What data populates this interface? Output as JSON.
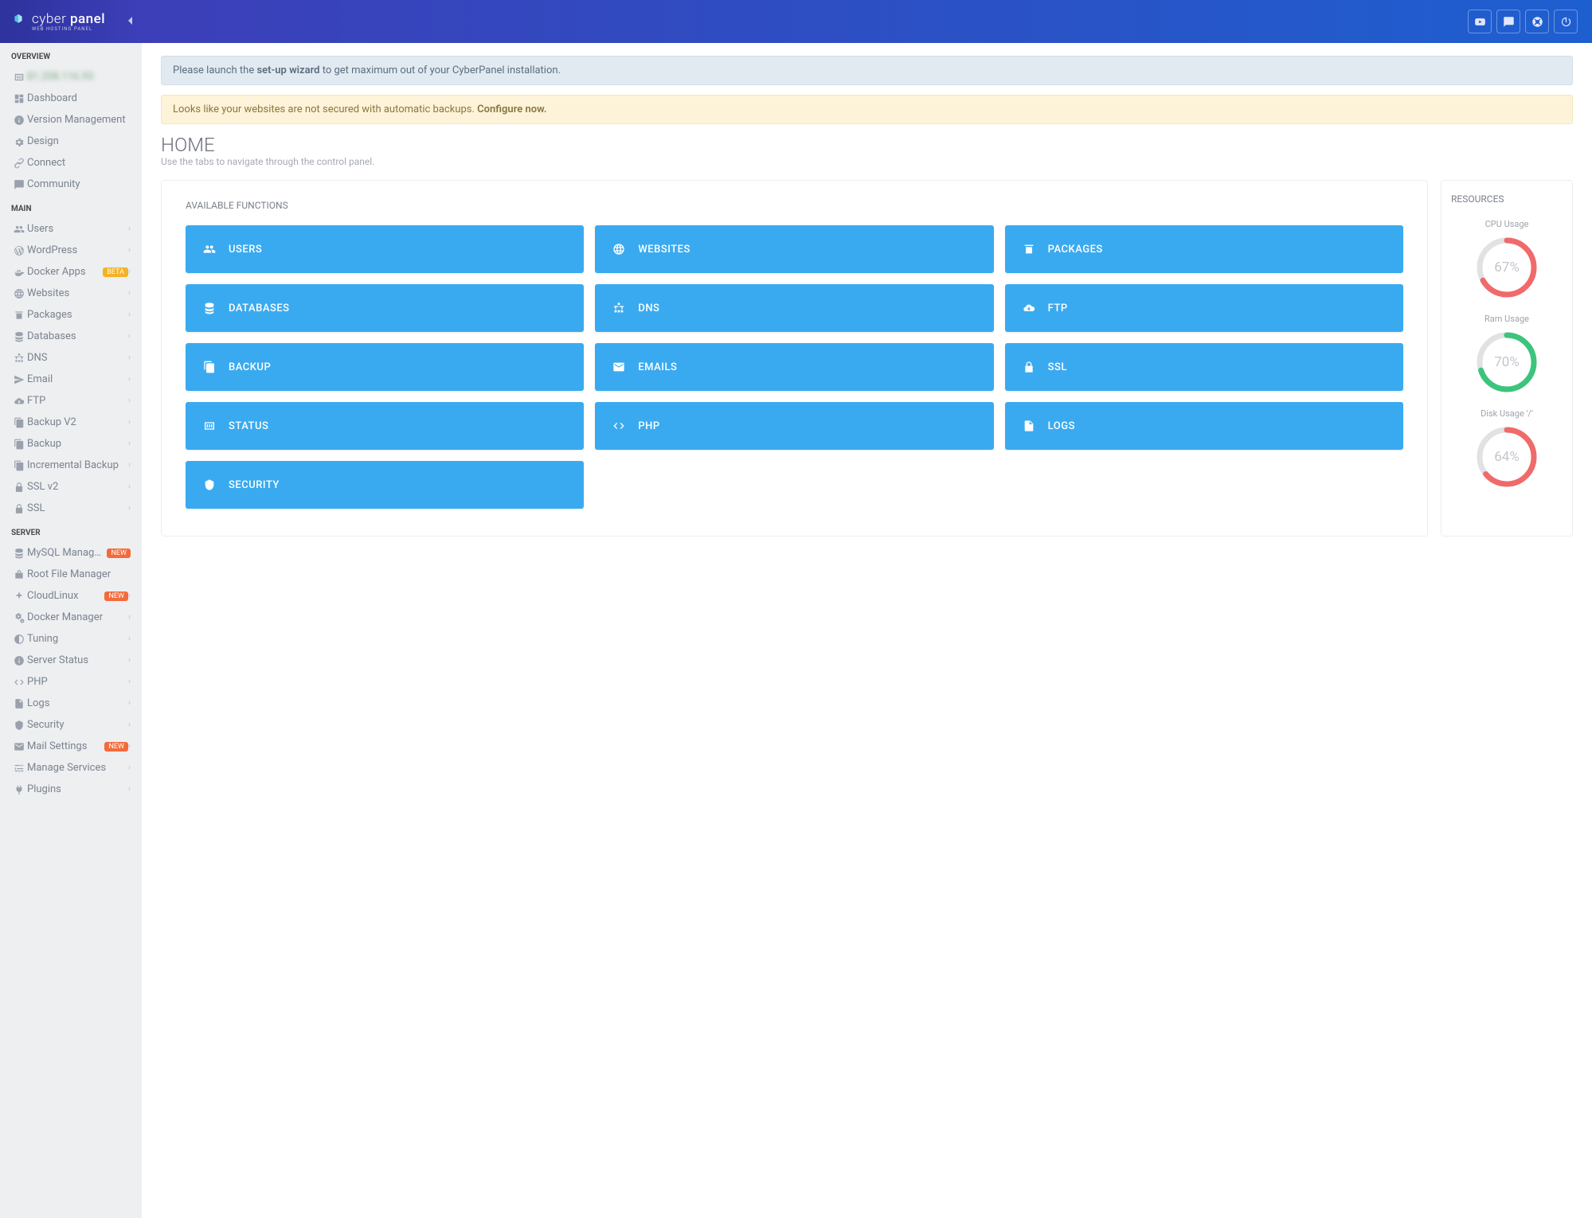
{
  "brand": {
    "name_a": "cyber",
    "name_b": "panel",
    "sub": "WEB HOSTING PANEL"
  },
  "nav": {
    "overview_title": "OVERVIEW",
    "ip": "81.208.116.93",
    "overview": [
      {
        "id": "dashboard",
        "label": "Dashboard",
        "icon": "dashboard",
        "chev": false
      },
      {
        "id": "version-management",
        "label": "Version Management",
        "icon": "info",
        "chev": false
      },
      {
        "id": "design",
        "label": "Design",
        "icon": "gear",
        "chev": false
      },
      {
        "id": "connect",
        "label": "Connect",
        "icon": "link",
        "chev": false
      },
      {
        "id": "community",
        "label": "Community",
        "icon": "chat",
        "chev": false
      }
    ],
    "main_title": "MAIN",
    "main": [
      {
        "id": "users",
        "label": "Users",
        "icon": "users",
        "chev": true
      },
      {
        "id": "wordpress",
        "label": "WordPress",
        "icon": "wordpress",
        "chev": true
      },
      {
        "id": "docker-apps",
        "label": "Docker Apps",
        "icon": "docker",
        "chev": true,
        "badge": "BETA",
        "badge_cls": "badge-beta"
      },
      {
        "id": "websites",
        "label": "Websites",
        "icon": "globe",
        "chev": true
      },
      {
        "id": "packages",
        "label": "Packages",
        "icon": "archive",
        "chev": true
      },
      {
        "id": "databases",
        "label": "Databases",
        "icon": "db",
        "chev": true
      },
      {
        "id": "dns",
        "label": "DNS",
        "icon": "sitemap",
        "chev": true
      },
      {
        "id": "email",
        "label": "Email",
        "icon": "paperplane",
        "chev": true
      },
      {
        "id": "ftp",
        "label": "FTP",
        "icon": "cloud",
        "chev": true
      },
      {
        "id": "backup-v2",
        "label": "Backup V2",
        "icon": "copy",
        "chev": true
      },
      {
        "id": "backup",
        "label": "Backup",
        "icon": "copy",
        "chev": true
      },
      {
        "id": "incremental-backup",
        "label": "Incremental Backup",
        "icon": "copy",
        "chev": true
      },
      {
        "id": "ssl-v2",
        "label": "SSL v2",
        "icon": "lock",
        "chev": true
      },
      {
        "id": "ssl",
        "label": "SSL",
        "icon": "lock",
        "chev": true
      }
    ],
    "server_title": "SERVER",
    "server": [
      {
        "id": "mysql-manager",
        "label": "MySQL Manager",
        "icon": "db",
        "chev": false,
        "badge": "NEW",
        "badge_cls": "badge-new"
      },
      {
        "id": "root-file-manager",
        "label": "Root File Manager",
        "icon": "rootfm",
        "chev": false
      },
      {
        "id": "cloudlinux",
        "label": "CloudLinux",
        "icon": "cloudlinux",
        "chev": true,
        "badge": "NEW",
        "badge_cls": "badge-new"
      },
      {
        "id": "docker-manager",
        "label": "Docker Manager",
        "icon": "gears",
        "chev": true
      },
      {
        "id": "tuning",
        "label": "Tuning",
        "icon": "contrast",
        "chev": true
      },
      {
        "id": "server-status",
        "label": "Server Status",
        "icon": "info",
        "chev": true
      },
      {
        "id": "php",
        "label": "PHP",
        "icon": "code",
        "chev": true
      },
      {
        "id": "logs",
        "label": "Logs",
        "icon": "file",
        "chev": true
      },
      {
        "id": "security",
        "label": "Security",
        "icon": "shield",
        "chev": true
      },
      {
        "id": "mail-settings",
        "label": "Mail Settings",
        "icon": "envelope",
        "chev": true,
        "badge": "NEW",
        "badge_cls": "badge-new"
      },
      {
        "id": "manage-services",
        "label": "Manage Services",
        "icon": "sliders",
        "chev": true
      },
      {
        "id": "plugins",
        "label": "Plugins",
        "icon": "plug",
        "chev": true
      }
    ]
  },
  "alerts": {
    "info_pre": "Please launch the ",
    "info_bold": "set-up wizard",
    "info_post": " to get maximum out of your CyberPanel installation.",
    "warn_text": "Looks like your websites are not secured with automatic backups. ",
    "warn_link": "Configure now."
  },
  "page": {
    "title": "HOME",
    "subtitle": "Use the tabs to navigate through the control panel."
  },
  "functions": {
    "title": "AVAILABLE FUNCTIONS",
    "items": [
      {
        "id": "users",
        "label": "USERS",
        "icon": "users"
      },
      {
        "id": "websites",
        "label": "WEBSITES",
        "icon": "globe"
      },
      {
        "id": "packages",
        "label": "PACKAGES",
        "icon": "archive"
      },
      {
        "id": "databases",
        "label": "DATABASES",
        "icon": "db"
      },
      {
        "id": "dns",
        "label": "DNS",
        "icon": "sitemap"
      },
      {
        "id": "ftp",
        "label": "FTP",
        "icon": "cloud"
      },
      {
        "id": "backup",
        "label": "BACKUP",
        "icon": "copy"
      },
      {
        "id": "emails",
        "label": "EMAILS",
        "icon": "envelope"
      },
      {
        "id": "ssl",
        "label": "SSL",
        "icon": "lock"
      },
      {
        "id": "status",
        "label": "STATUS",
        "icon": "status"
      },
      {
        "id": "php",
        "label": "PHP",
        "icon": "code"
      },
      {
        "id": "logs",
        "label": "LOGS",
        "icon": "file"
      },
      {
        "id": "security",
        "label": "SECURITY",
        "icon": "shield"
      }
    ]
  },
  "resources": {
    "title": "RESOURCES",
    "gauges": [
      {
        "id": "cpu",
        "title": "CPU Usage",
        "value": 67,
        "color": "#f16a6a"
      },
      {
        "id": "ram",
        "title": "Ram Usage",
        "value": 70,
        "color": "#3cc47c"
      },
      {
        "id": "disk",
        "title": "Disk Usage '/'",
        "value": 64,
        "color": "#f16a6a"
      }
    ]
  },
  "topbar": [
    {
      "id": "youtube",
      "icon": "youtube"
    },
    {
      "id": "chat",
      "icon": "chat"
    },
    {
      "id": "support",
      "icon": "life-ring"
    },
    {
      "id": "power",
      "icon": "power"
    }
  ]
}
